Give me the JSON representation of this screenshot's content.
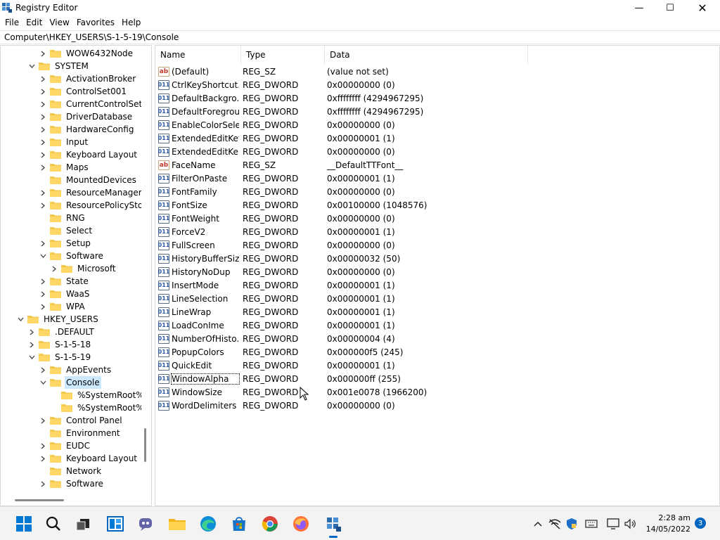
{
  "window": {
    "title": "Registry Editor",
    "controls": {
      "minimize": "—",
      "maximize": "☐",
      "close": "✕"
    }
  },
  "menu": [
    "File",
    "Edit",
    "View",
    "Favorites",
    "Help"
  ],
  "address": "Computer\\HKEY_USERS\\S-1-5-19\\Console",
  "tree": [
    {
      "label": "WOW6432Node",
      "expander": "collapsed"
    },
    {
      "label": "SYSTEM",
      "expander": "expanded"
    },
    {
      "label": "ActivationBroker",
      "expander": "collapsed"
    },
    {
      "label": "ControlSet001",
      "expander": "collapsed"
    },
    {
      "label": "CurrentControlSet",
      "expander": "collapsed"
    },
    {
      "label": "DriverDatabase",
      "expander": "collapsed"
    },
    {
      "label": "HardwareConfig",
      "expander": "collapsed"
    },
    {
      "label": "Input",
      "expander": "collapsed"
    },
    {
      "label": "Keyboard Layout",
      "expander": "collapsed"
    },
    {
      "label": "Maps",
      "expander": "collapsed"
    },
    {
      "label": "MountedDevices",
      "expander": "none"
    },
    {
      "label": "ResourceManager",
      "expander": "collapsed"
    },
    {
      "label": "ResourcePolicyStore",
      "expander": "collapsed"
    },
    {
      "label": "RNG",
      "expander": "none"
    },
    {
      "label": "Select",
      "expander": "none"
    },
    {
      "label": "Setup",
      "expander": "collapsed"
    },
    {
      "label": "Software",
      "expander": "expanded"
    },
    {
      "label": "Microsoft",
      "expander": "collapsed"
    },
    {
      "label": "State",
      "expander": "collapsed"
    },
    {
      "label": "WaaS",
      "expander": "collapsed"
    },
    {
      "label": "WPA",
      "expander": "collapsed"
    },
    {
      "label": "HKEY_USERS",
      "expander": "expanded"
    },
    {
      "label": ".DEFAULT",
      "expander": "collapsed"
    },
    {
      "label": "S-1-5-18",
      "expander": "collapsed"
    },
    {
      "label": "S-1-5-19",
      "expander": "expanded"
    },
    {
      "label": "AppEvents",
      "expander": "collapsed"
    },
    {
      "label": "Console",
      "expander": "expanded",
      "selected": true
    },
    {
      "label": "%SystemRoot%_S",
      "expander": "none"
    },
    {
      "label": "%SystemRoot%_S",
      "expander": "none"
    },
    {
      "label": "Control Panel",
      "expander": "collapsed"
    },
    {
      "label": "Environment",
      "expander": "none"
    },
    {
      "label": "EUDC",
      "expander": "collapsed"
    },
    {
      "label": "Keyboard Layout",
      "expander": "collapsed"
    },
    {
      "label": "Network",
      "expander": "none"
    },
    {
      "label": "Software",
      "expander": "collapsed"
    }
  ],
  "columns": {
    "name": "Name",
    "type": "Type",
    "data": "Data"
  },
  "values": [
    {
      "name": "(Default)",
      "type": "REG_SZ",
      "data": "(value not set)",
      "icon": "ab"
    },
    {
      "name": "CtrlKeyShortcut...",
      "type": "REG_DWORD",
      "data": "0x00000000 (0)",
      "icon": "011"
    },
    {
      "name": "DefaultBackgro...",
      "type": "REG_DWORD",
      "data": "0xffffffff (4294967295)",
      "icon": "011"
    },
    {
      "name": "DefaultForegrou...",
      "type": "REG_DWORD",
      "data": "0xffffffff (4294967295)",
      "icon": "011"
    },
    {
      "name": "EnableColorSele...",
      "type": "REG_DWORD",
      "data": "0x00000000 (0)",
      "icon": "011"
    },
    {
      "name": "ExtendedEditKey",
      "type": "REG_DWORD",
      "data": "0x00000001 (1)",
      "icon": "011"
    },
    {
      "name": "ExtendedEditKe...",
      "type": "REG_DWORD",
      "data": "0x00000000 (0)",
      "icon": "011"
    },
    {
      "name": "FaceName",
      "type": "REG_SZ",
      "data": "__DefaultTTFont__",
      "icon": "ab"
    },
    {
      "name": "FilterOnPaste",
      "type": "REG_DWORD",
      "data": "0x00000001 (1)",
      "icon": "011"
    },
    {
      "name": "FontFamily",
      "type": "REG_DWORD",
      "data": "0x00000000 (0)",
      "icon": "011"
    },
    {
      "name": "FontSize",
      "type": "REG_DWORD",
      "data": "0x00100000 (1048576)",
      "icon": "011"
    },
    {
      "name": "FontWeight",
      "type": "REG_DWORD",
      "data": "0x00000000 (0)",
      "icon": "011"
    },
    {
      "name": "ForceV2",
      "type": "REG_DWORD",
      "data": "0x00000001 (1)",
      "icon": "011"
    },
    {
      "name": "FullScreen",
      "type": "REG_DWORD",
      "data": "0x00000000 (0)",
      "icon": "011"
    },
    {
      "name": "HistoryBufferSize",
      "type": "REG_DWORD",
      "data": "0x00000032 (50)",
      "icon": "011"
    },
    {
      "name": "HistoryNoDup",
      "type": "REG_DWORD",
      "data": "0x00000000 (0)",
      "icon": "011"
    },
    {
      "name": "InsertMode",
      "type": "REG_DWORD",
      "data": "0x00000001 (1)",
      "icon": "011"
    },
    {
      "name": "LineSelection",
      "type": "REG_DWORD",
      "data": "0x00000001 (1)",
      "icon": "011"
    },
    {
      "name": "LineWrap",
      "type": "REG_DWORD",
      "data": "0x00000001 (1)",
      "icon": "011"
    },
    {
      "name": "LoadConIme",
      "type": "REG_DWORD",
      "data": "0x00000001 (1)",
      "icon": "011"
    },
    {
      "name": "NumberOfHisto...",
      "type": "REG_DWORD",
      "data": "0x00000004 (4)",
      "icon": "011"
    },
    {
      "name": "PopupColors",
      "type": "REG_DWORD",
      "data": "0x000000f5 (245)",
      "icon": "011"
    },
    {
      "name": "QuickEdit",
      "type": "REG_DWORD",
      "data": "0x00000001 (1)",
      "icon": "011"
    },
    {
      "name": "WindowAlpha",
      "type": "REG_DWORD",
      "data": "0x000000ff (255)",
      "icon": "011",
      "focused": true
    },
    {
      "name": "WindowSize",
      "type": "REG_DWORD",
      "data": "0x001e0078 (1966200)",
      "icon": "011"
    },
    {
      "name": "WordDelimiters",
      "type": "REG_DWORD",
      "data": "0x00000000 (0)",
      "icon": "011"
    }
  ],
  "taskbar": {
    "apps": [
      "start-icon",
      "search-icon",
      "task-view-icon",
      "widgets-icon",
      "teams-chat-icon",
      "file-explorer-icon",
      "edge-icon",
      "store-icon",
      "chrome-icon",
      "firefox-icon",
      "registry-editor-icon"
    ],
    "tray": [
      "chevron-up-icon",
      "network-off-icon",
      "defender-icon",
      "keyboard-icon",
      "monitor-icon",
      "volume-icon"
    ],
    "time": "2:28 am",
    "date": "14/05/2022",
    "notifications": "3"
  },
  "colors": {
    "selection": "#cce8ff",
    "folder": "#f2c94c",
    "accent": "#0067c0"
  }
}
